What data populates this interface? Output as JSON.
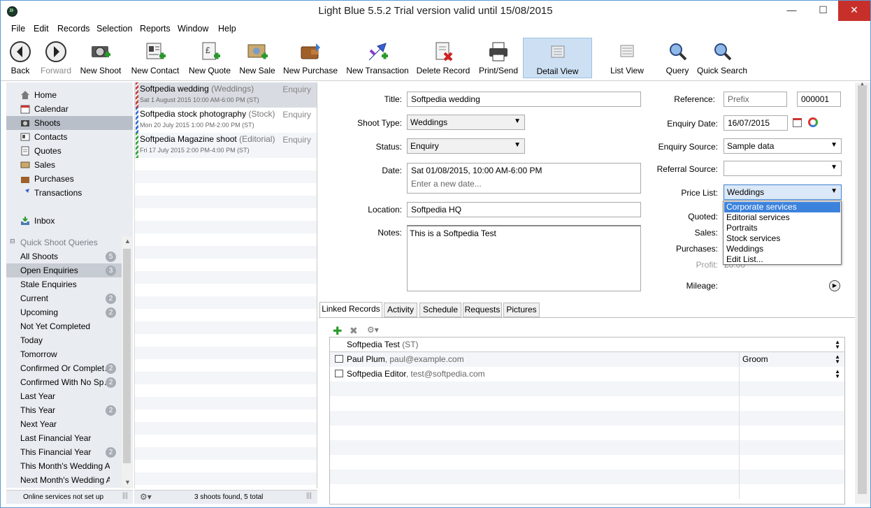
{
  "window": {
    "title": "Light Blue 5.5.2    Trial version valid until 15/08/2015",
    "minimize": "—",
    "maximize": "☐",
    "close": "✕"
  },
  "menu": [
    "File",
    "Edit",
    "Records",
    "Selection",
    "Reports",
    "Window",
    "Help"
  ],
  "toolbar": [
    {
      "label": "Back",
      "icon": "back-arrow-icon"
    },
    {
      "label": "Forward",
      "icon": "forward-arrow-icon"
    },
    {
      "label": "New Shoot",
      "icon": "camera-add-icon"
    },
    {
      "label": "New Contact",
      "icon": "contact-card-add-icon"
    },
    {
      "label": "New Quote",
      "icon": "quote-add-icon"
    },
    {
      "label": "New Sale",
      "icon": "sale-add-icon"
    },
    {
      "label": "New Purchase",
      "icon": "wallet-icon"
    },
    {
      "label": "New Transaction",
      "icon": "transaction-arrows-icon"
    },
    {
      "label": "Delete Record",
      "icon": "delete-record-icon"
    },
    {
      "label": "Print/Send",
      "icon": "printer-icon"
    },
    {
      "label": "Detail View",
      "icon": "detail-view-icon"
    },
    {
      "label": "List View",
      "icon": "list-view-icon"
    },
    {
      "label": "Query",
      "icon": "magnifier-icon"
    },
    {
      "label": "Quick Search",
      "icon": "quick-search-icon"
    }
  ],
  "sidebar": {
    "nav": [
      {
        "label": "Home",
        "icon": "home-icon"
      },
      {
        "label": "Calendar",
        "icon": "calendar-icon"
      },
      {
        "label": "Shoots",
        "icon": "camera-icon"
      },
      {
        "label": "Contacts",
        "icon": "contacts-icon"
      },
      {
        "label": "Quotes",
        "icon": "quotes-icon"
      },
      {
        "label": "Sales",
        "icon": "sales-icon"
      },
      {
        "label": "Purchases",
        "icon": "purchases-icon"
      },
      {
        "label": "Transactions",
        "icon": "transactions-icon"
      },
      {
        "label": "Inbox",
        "icon": "inbox-icon"
      }
    ],
    "queries_header": "Quick Shoot Queries",
    "queries": [
      {
        "label": "All Shoots",
        "badge": "5"
      },
      {
        "label": "Open Enquiries",
        "badge": "3"
      },
      {
        "label": "Stale Enquiries",
        "badge": ""
      },
      {
        "label": "Current",
        "badge": "2"
      },
      {
        "label": "Upcoming",
        "badge": "2"
      },
      {
        "label": "Not Yet Completed",
        "badge": ""
      },
      {
        "label": "Today",
        "badge": ""
      },
      {
        "label": "Tomorrow",
        "badge": ""
      },
      {
        "label": "Confirmed Or Complet…",
        "badge": "2"
      },
      {
        "label": "Confirmed With No Sp…",
        "badge": "2"
      },
      {
        "label": "Last Year",
        "badge": ""
      },
      {
        "label": "This Year",
        "badge": "2"
      },
      {
        "label": "Next Year",
        "badge": ""
      },
      {
        "label": "Last Financial Year",
        "badge": ""
      },
      {
        "label": "This Financial Year",
        "badge": "2"
      },
      {
        "label": "This Month's Wedding An…",
        "badge": ""
      },
      {
        "label": "Next Month's Wedding A…",
        "badge": ""
      }
    ],
    "status": "Online services not set up"
  },
  "records": [
    {
      "title": "Softpedia wedding",
      "category": "(Weddings)",
      "status": "Enquiry",
      "date": "Sat 1 August 2015 10:00 AM-6:00 PM (ST)",
      "color": "#c94040"
    },
    {
      "title": "Softpedia stock photography",
      "category": "(Stock)",
      "status": "Enquiry",
      "date": "Mon 20 July 2015 1:00 PM-2:00 PM (ST)",
      "color": "#3c6fd0"
    },
    {
      "title": "Softpedia Magazine shoot",
      "category": "(Editorial)",
      "status": "Enquiry",
      "date": "Fri 17 July 2015 2:00 PM-4:00 PM (ST)",
      "color": "#39a845"
    }
  ],
  "list_status": "3 shoots found, 5 total",
  "form": {
    "title_label": "Title:",
    "title_value": "Softpedia wedding",
    "shoot_type_label": "Shoot Type:",
    "shoot_type_value": "Weddings",
    "status_label": "Status:",
    "status_value": "Enquiry",
    "date_label": "Date:",
    "date_value": "Sat 01/08/2015, 10:00 AM-6:00 PM",
    "date_placeholder": "Enter a new date...",
    "location_label": "Location:",
    "location_value": "Softpedia HQ",
    "notes_label": "Notes:",
    "notes_value": "This is a Softpedia Test",
    "reference_label": "Reference:",
    "reference_prefix": "Prefix",
    "reference_value": "000001",
    "enquiry_date_label": "Enquiry Date:",
    "enquiry_date_value": "16/07/2015",
    "enquiry_source_label": "Enquiry Source:",
    "enquiry_source_value": "Sample data",
    "referral_source_label": "Referral Source:",
    "referral_source_value": "",
    "price_list_label": "Price List:",
    "price_list_value": "Weddings",
    "quoted_label": "Quoted:",
    "sales_label": "Sales:",
    "purchases_label": "Purchases:",
    "profit_label": "Profit:",
    "profit_value": "£0.00",
    "mileage_label": "Mileage:"
  },
  "price_list_options": [
    "Corporate services",
    "Editorial services",
    "Portraits",
    "Stock services",
    "Weddings",
    "Edit List..."
  ],
  "tabs": [
    "Linked Records",
    "Activity",
    "Schedule",
    "Requests",
    "Pictures"
  ],
  "linked": {
    "header": {
      "name": "Softpedia Test",
      "sub": "(ST)"
    },
    "rows": [
      {
        "name": "Paul Plum",
        "sub": ", paul@example.com",
        "role": "Groom"
      },
      {
        "name": "Softpedia Editor",
        "sub": ", test@softpedia.com",
        "role": ""
      }
    ]
  }
}
